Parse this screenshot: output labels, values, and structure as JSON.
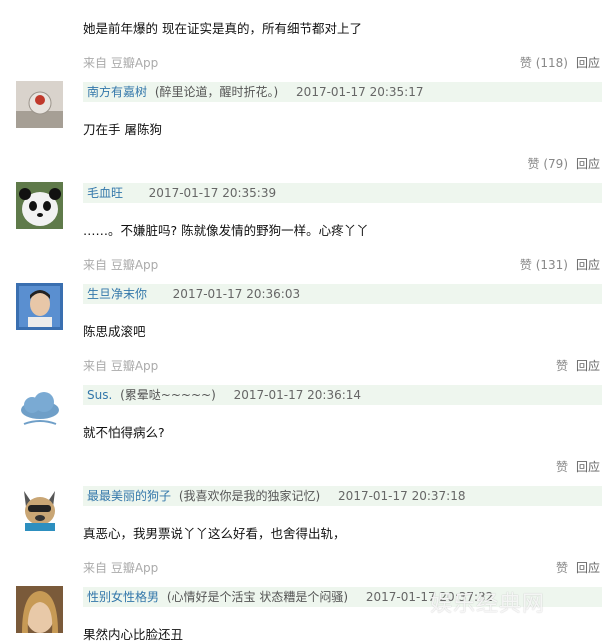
{
  "fragment": {
    "text": "她是前年爆的 现在证实是真的，所有细节都对上了",
    "source": "来自 豆瓣App",
    "like": "赞 (118)",
    "reply": "回应"
  },
  "comments": [
    {
      "username": "南方有嘉树",
      "status": "(醉里论道，醒时折花。)",
      "time": "2017-01-17 20:35:17",
      "text": "刀在手 屠陈狗",
      "source": "",
      "like": "赞 (79)",
      "reply": "回应"
    },
    {
      "username": "毛血旺",
      "status": "",
      "time": "2017-01-17 20:35:39",
      "text": "……。不嫌脏吗? 陈就像发情的野狗一样。心疼丫丫",
      "source": "来自 豆瓣App",
      "like": "赞 (131)",
      "reply": "回应"
    },
    {
      "username": "生旦净末你",
      "status": "",
      "time": "2017-01-17 20:36:03",
      "text": "陈思成滚吧",
      "source": "来自 豆瓣App",
      "like": "赞",
      "reply": "回应"
    },
    {
      "username": "Sus.",
      "status": "(累晕哒~~~~~)",
      "time": "2017-01-17 20:36:14",
      "text": "就不怕得病么?",
      "source": "",
      "like": "赞",
      "reply": "回应"
    },
    {
      "username": "最最美丽的狗子",
      "status": "(我喜欢你是我的独家记忆)",
      "time": "2017-01-17 20:37:18",
      "text": "真恶心，我男票说丫丫这么好看，也舍得出轨，",
      "source": "来自 豆瓣App",
      "like": "赞",
      "reply": "回应"
    },
    {
      "username": "性别女性格男",
      "status": "(心情好是个活宝 状态糟是个闷骚)",
      "time": "2017-01-17 20:37:32",
      "text": "果然内心比脸还丑",
      "source": "",
      "like": "",
      "reply": ""
    }
  ],
  "watermark": "娱乐经典网"
}
